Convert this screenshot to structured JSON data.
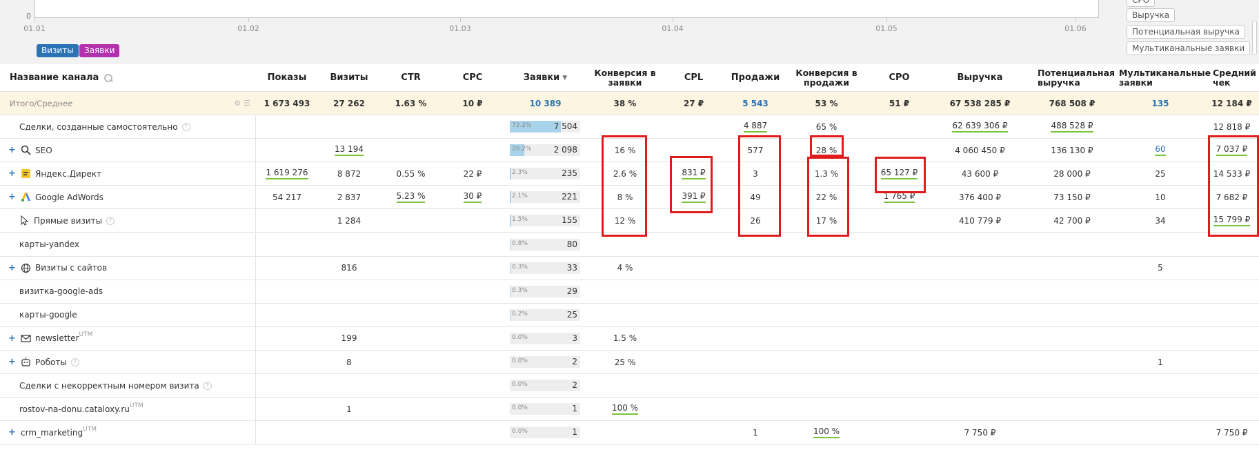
{
  "chart": {
    "y_zero": "0",
    "x_ticks": [
      "01.01",
      "01.02",
      "01.03",
      "01.04",
      "01.05",
      "01.06"
    ],
    "legend": [
      "Визиты",
      "Заявки"
    ],
    "legend_colors": [
      "#2b73b5",
      "#b431ad"
    ],
    "metric_chips": [
      "СРО",
      "Выручка",
      "Потенциальная выручка",
      "Мультиканальные заявки"
    ]
  },
  "columns": {
    "channel": "Название канала",
    "impressions": "Показы",
    "visits": "Визиты",
    "ctr": "CTR",
    "cpc": "CPC",
    "leads": "Заявки",
    "conv_leads": "Конверсия в заявки",
    "cpl": "CPL",
    "sales": "Продажи",
    "conv_sales": "Конверсия в продажи",
    "cpo": "CPO",
    "revenue": "Выручка",
    "potential_revenue": "Потенциальная выручка",
    "multichannel": "Мультиканальные заявки",
    "avg_check": "Средний чек"
  },
  "totals": {
    "label": "Итого/Среднее",
    "impressions": "1 673 493",
    "visits": "27 262",
    "ctr": "1.63 %",
    "cpc": "10 ₽",
    "leads": "10 389",
    "conv_leads": "38 %",
    "cpl": "27 ₽",
    "sales": "5 543",
    "conv_sales": "53 %",
    "cpo": "51 ₽",
    "revenue": "67 538 285 ₽",
    "potential_revenue": "768 508 ₽",
    "multichannel": "135",
    "avg_check": "12 184 ₽"
  },
  "rows": [
    {
      "name": "Сделки, созданные самостоятельно",
      "expand": false,
      "icon": "",
      "help": true,
      "utm": false,
      "impressions": "",
      "visits": "",
      "ctr": "",
      "cpc": "",
      "lead_pct": "72.2%",
      "lead_share": 0.722,
      "leads": "7 504",
      "conv_leads": "",
      "cpl": "",
      "sales": "4 887",
      "conv_sales": "65 %",
      "cpo": "",
      "revenue": "62 639 306 ₽",
      "potential_revenue": "488 528 ₽",
      "multichannel": "",
      "avg_check": "12 818 ₽"
    },
    {
      "name": "SEO",
      "expand": true,
      "icon": "search-icon",
      "help": false,
      "utm": false,
      "impressions": "",
      "visits": "13 194",
      "ctr": "",
      "cpc": "",
      "lead_pct": "20.2%",
      "lead_share": 0.202,
      "leads": "2 098",
      "conv_leads": "16 %",
      "cpl": "",
      "sales": "577",
      "conv_sales": "28 %",
      "cpo": "",
      "revenue": "4 060 450 ₽",
      "potential_revenue": "136 130 ₽",
      "multichannel": "60",
      "avg_check": "7 037 ₽"
    },
    {
      "name": "Яндекс.Директ",
      "expand": true,
      "icon": "yandex-direct-icon",
      "help": false,
      "utm": false,
      "impressions": "1 619 276",
      "visits": "8 872",
      "ctr": "0.55 %",
      "cpc": "22 ₽",
      "lead_pct": "2.3%",
      "lead_share": 0.023,
      "leads": "235",
      "conv_leads": "2.6 %",
      "cpl": "831 ₽",
      "sales": "3",
      "conv_sales": "1.3 %",
      "cpo": "65 127 ₽",
      "revenue": "43 600 ₽",
      "potential_revenue": "28 000 ₽",
      "multichannel": "25",
      "avg_check": "14 533 ₽"
    },
    {
      "name": "Google AdWords",
      "expand": true,
      "icon": "google-ads-icon",
      "help": false,
      "utm": false,
      "impressions": "54 217",
      "visits": "2 837",
      "ctr": "5.23 %",
      "cpc": "30 ₽",
      "lead_pct": "2.1%",
      "lead_share": 0.021,
      "leads": "221",
      "conv_leads": "8 %",
      "cpl": "391 ₽",
      "sales": "49",
      "conv_sales": "22 %",
      "cpo": "1 765 ₽",
      "revenue": "376 400 ₽",
      "potential_revenue": "73 150 ₽",
      "multichannel": "10",
      "avg_check": "7 682 ₽"
    },
    {
      "name": "Прямые визиты",
      "expand": false,
      "icon": "cursor-icon",
      "help": true,
      "utm": false,
      "impressions": "",
      "visits": "1 284",
      "ctr": "",
      "cpc": "",
      "lead_pct": "1.5%",
      "lead_share": 0.015,
      "leads": "155",
      "conv_leads": "12 %",
      "cpl": "",
      "sales": "26",
      "conv_sales": "17 %",
      "cpo": "",
      "revenue": "410 779 ₽",
      "potential_revenue": "42 700 ₽",
      "multichannel": "34",
      "avg_check": "15 799 ₽"
    },
    {
      "name": "карты-yandex",
      "expand": false,
      "icon": "",
      "help": false,
      "utm": false,
      "impressions": "",
      "visits": "",
      "ctr": "",
      "cpc": "",
      "lead_pct": "0.8%",
      "lead_share": 0.008,
      "leads": "80",
      "conv_leads": "",
      "cpl": "",
      "sales": "",
      "conv_sales": "",
      "cpo": "",
      "revenue": "",
      "potential_revenue": "",
      "multichannel": "",
      "avg_check": ""
    },
    {
      "name": "Визиты с сайтов",
      "expand": true,
      "icon": "globe-icon",
      "help": false,
      "utm": false,
      "impressions": "",
      "visits": "816",
      "ctr": "",
      "cpc": "",
      "lead_pct": "0.3%",
      "lead_share": 0.003,
      "leads": "33",
      "conv_leads": "4 %",
      "cpl": "",
      "sales": "",
      "conv_sales": "",
      "cpo": "",
      "revenue": "",
      "potential_revenue": "",
      "multichannel": "5",
      "avg_check": ""
    },
    {
      "name": "визитка-google-ads",
      "expand": false,
      "icon": "",
      "help": false,
      "utm": false,
      "impressions": "",
      "visits": "",
      "ctr": "",
      "cpc": "",
      "lead_pct": "0.3%",
      "lead_share": 0.003,
      "leads": "29",
      "conv_leads": "",
      "cpl": "",
      "sales": "",
      "conv_sales": "",
      "cpo": "",
      "revenue": "",
      "potential_revenue": "",
      "multichannel": "",
      "avg_check": ""
    },
    {
      "name": "карты-google",
      "expand": false,
      "icon": "",
      "help": false,
      "utm": false,
      "impressions": "",
      "visits": "",
      "ctr": "",
      "cpc": "",
      "lead_pct": "0.2%",
      "lead_share": 0.002,
      "leads": "25",
      "conv_leads": "",
      "cpl": "",
      "sales": "",
      "conv_sales": "",
      "cpo": "",
      "revenue": "",
      "potential_revenue": "",
      "multichannel": "",
      "avg_check": ""
    },
    {
      "name": "newsletter",
      "expand": true,
      "icon": "mail-icon",
      "help": false,
      "utm": true,
      "impressions": "",
      "visits": "199",
      "ctr": "",
      "cpc": "",
      "lead_pct": "0.0%",
      "lead_share": 0.0,
      "leads": "3",
      "conv_leads": "1.5 %",
      "cpl": "",
      "sales": "",
      "conv_sales": "",
      "cpo": "",
      "revenue": "",
      "potential_revenue": "",
      "multichannel": "",
      "avg_check": ""
    },
    {
      "name": "Роботы",
      "expand": true,
      "icon": "robot-icon",
      "help": true,
      "utm": false,
      "impressions": "",
      "visits": "8",
      "ctr": "",
      "cpc": "",
      "lead_pct": "0.0%",
      "lead_share": 0.0,
      "leads": "2",
      "conv_leads": "25 %",
      "cpl": "",
      "sales": "",
      "conv_sales": "",
      "cpo": "",
      "revenue": "",
      "potential_revenue": "",
      "multichannel": "1",
      "avg_check": ""
    },
    {
      "name": "Сделки с некорректным номером визита",
      "expand": false,
      "icon": "",
      "help": true,
      "utm": false,
      "impressions": "",
      "visits": "",
      "ctr": "",
      "cpc": "",
      "lead_pct": "0.0%",
      "lead_share": 0.0,
      "leads": "2",
      "conv_leads": "",
      "cpl": "",
      "sales": "",
      "conv_sales": "",
      "cpo": "",
      "revenue": "",
      "potential_revenue": "",
      "multichannel": "",
      "avg_check": ""
    },
    {
      "name": "rostov-na-donu.cataloxy.ru",
      "expand": false,
      "icon": "",
      "help": false,
      "utm": true,
      "impressions": "",
      "visits": "1",
      "ctr": "",
      "cpc": "",
      "lead_pct": "0.0%",
      "lead_share": 0.0,
      "leads": "1",
      "conv_leads": "100 %",
      "cpl": "",
      "sales": "",
      "conv_sales": "",
      "cpo": "",
      "revenue": "",
      "potential_revenue": "",
      "multichannel": "",
      "avg_check": ""
    },
    {
      "name": "crm_marketing",
      "expand": true,
      "icon": "",
      "help": false,
      "utm": true,
      "impressions": "",
      "visits": "",
      "ctr": "",
      "cpc": "",
      "lead_pct": "0.0%",
      "lead_share": 0.0,
      "leads": "1",
      "conv_leads": "",
      "cpl": "",
      "sales": "1",
      "conv_sales": "100 %",
      "cpo": "",
      "revenue": "7 750 ₽",
      "potential_revenue": "",
      "multichannel": "",
      "avg_check": "7 750 ₽"
    }
  ],
  "utm_label": "UTM",
  "accent": "#2b73b5",
  "highlight_color": "#e01b1b"
}
